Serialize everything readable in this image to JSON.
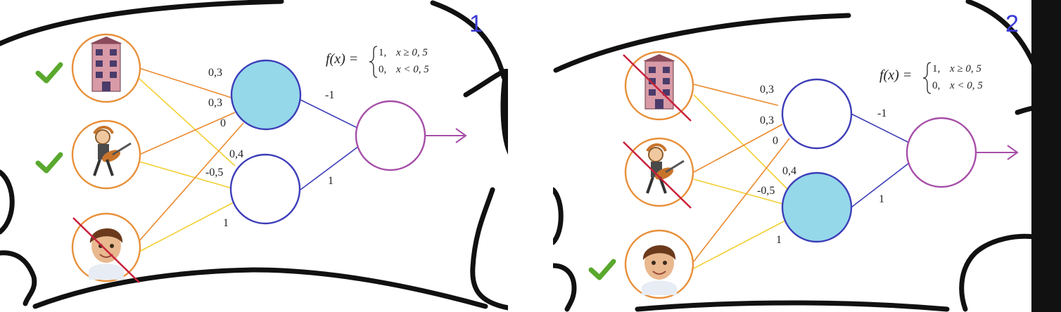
{
  "panels": [
    {
      "number": "1",
      "inputs": [
        {
          "icon": "building-icon",
          "status": "check"
        },
        {
          "icon": "rock-guitarist-icon",
          "status": "check"
        },
        {
          "icon": "boy-face-icon",
          "status": "crossed"
        }
      ],
      "active_hidden": "top",
      "weights_in": [
        "0,3",
        "0,3",
        "0",
        "0,4",
        "-0,5",
        "1"
      ],
      "weights_out": [
        "-1",
        "1"
      ],
      "formula": {
        "lhs": "f(x) =",
        "case1_value": "1,",
        "case1_cond": "x ≥ 0, 5",
        "case2_value": "0,",
        "case2_cond": "x < 0, 5"
      }
    },
    {
      "number": "2",
      "inputs": [
        {
          "icon": "building-icon",
          "status": "crossed"
        },
        {
          "icon": "rock-guitarist-icon",
          "status": "crossed"
        },
        {
          "icon": "boy-face-icon",
          "status": "check"
        }
      ],
      "active_hidden": "bottom",
      "weights_in": [
        "0,3",
        "0,3",
        "0",
        "0,4",
        "-0,5",
        "1"
      ],
      "weights_out": [
        "-1",
        "1"
      ],
      "formula": {
        "lhs": "f(x) =",
        "case1_value": "1,",
        "case1_cond": "x ≥ 0, 5",
        "case2_value": "0,",
        "case2_cond": "x < 0, 5"
      }
    }
  ],
  "colors": {
    "input_ring": "#e8903a",
    "hidden_ring": "#3d3db8",
    "output_ring": "#a64ea8",
    "active_fill": "#94d8ea",
    "edge_orange": "#ec8a2e",
    "edge_yellow": "#f2cf32",
    "edge_blue": "#3d3db8",
    "check": "#5aa82e",
    "cross": "#c8203a"
  }
}
